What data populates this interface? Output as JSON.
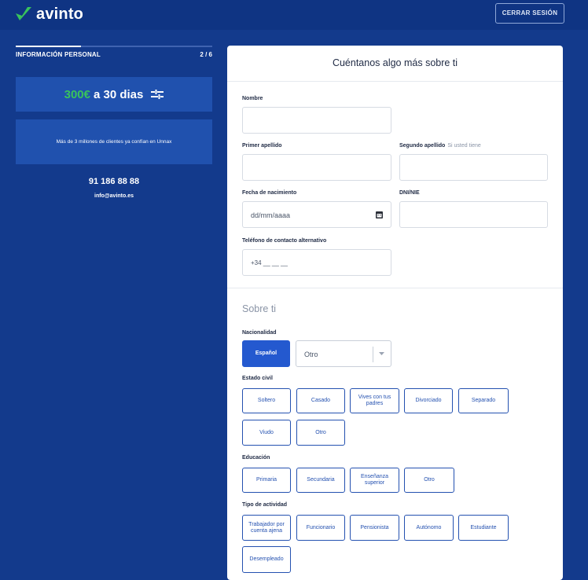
{
  "app": {
    "name": "avinto",
    "logout_label": "CERRAR SESIÓN"
  },
  "sidebar": {
    "step_label": "INFORMACIÓN PERSONAL",
    "step_count": "2 / 6",
    "progress": 0.333,
    "promo_amount": "300€",
    "promo_rest": "a 30 dias",
    "trust_text": "Más de 3 millones de clientes ya confían en Unnax",
    "phone": "91 186 88 88",
    "email": "info@avinto.es"
  },
  "form": {
    "title": "Cuéntanos algo más sobre ti",
    "nombre_label": "Nombre",
    "primer_apellido_label": "Primer apellido",
    "segundo_apellido_label": "Segundo apellido",
    "segundo_apellido_hint": "Si usted tiene",
    "fecha_label": "Fecha de nacimiento",
    "fecha_placeholder": "dd/mm/aaaa",
    "dni_label": "DNI/NIE",
    "telefono_label": "Teléfono de contacto alternativo",
    "telefono_placeholder": "+34 __ __ __"
  },
  "about": {
    "title": "Sobre ti",
    "nacionalidad_label": "Nacionalidad",
    "nacionalidad_selected": "Español",
    "nacionalidad_other_value": "Otro",
    "estado_civil_label": "Estado civil",
    "estado_civil_options": [
      "Soltero",
      "Casado",
      "Vives con tus padres",
      "Divorciado",
      "Separado",
      "Viudo",
      "Otro"
    ],
    "educacion_label": "Educación",
    "educacion_options": [
      "Primaria",
      "Secundaria",
      "Enseñanza superior",
      "Otro"
    ],
    "actividad_label": "Tipo de actividad",
    "actividad_options": [
      "Trabajador por cuenta ajena",
      "Funcionario",
      "Pensionista",
      "Autónomo",
      "Estudiante",
      "Desempleado"
    ]
  },
  "colors": {
    "background": "#133a8c",
    "topbar": "#0f3483",
    "panel": "#2051ae",
    "accent_green": "#39c35c",
    "button_primary": "#2459cf",
    "button_border": "#2451b0"
  }
}
